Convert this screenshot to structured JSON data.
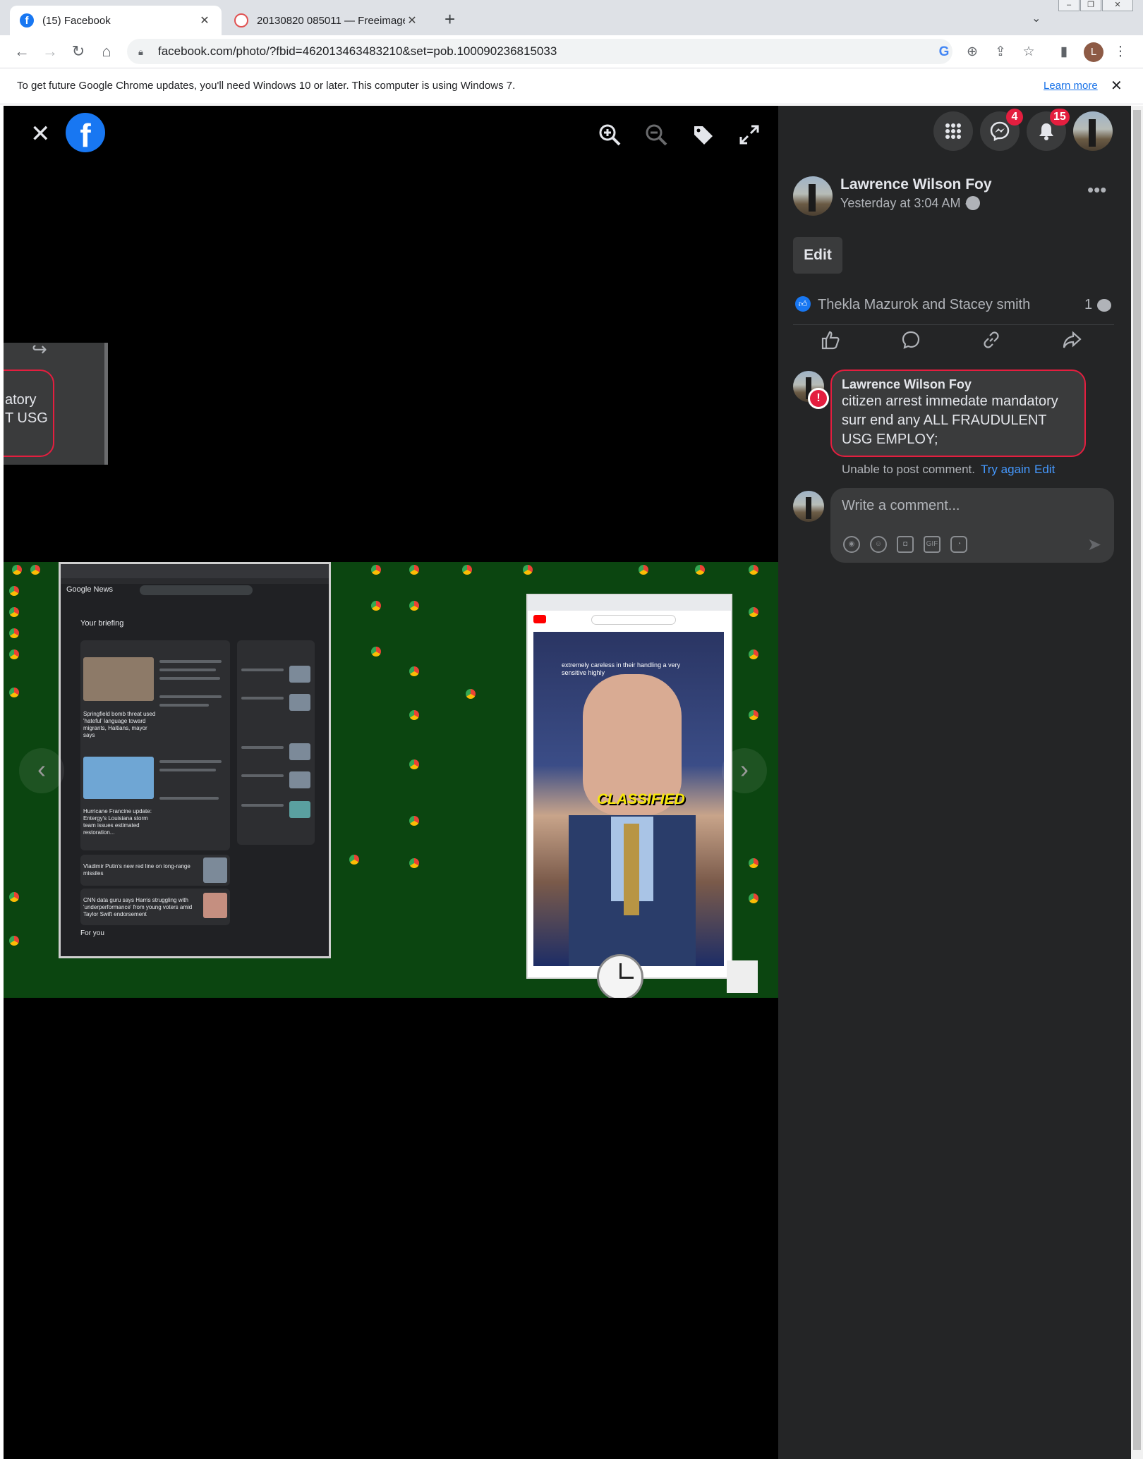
{
  "browser": {
    "tabs": [
      {
        "title": "(15) Facebook",
        "active": true
      },
      {
        "title": "20130820 085011 — Freeimage.host",
        "active": false
      }
    ],
    "new_tab": "+",
    "url": "facebook.com/photo/?fbid=462013463483210&set=pob.100090236815033",
    "profile_initial": "L",
    "infobar": {
      "message": "To get future Google Chrome updates, you'll need Windows 10 or later. This computer is using Windows 7.",
      "link": "Learn more"
    }
  },
  "viewer": {
    "snippet_text": "atory\nT USG",
    "photo": {
      "news_title": "Google News",
      "news_briefing": "Your briefing",
      "news_headline_1": "Springfield bomb threat used 'hateful' language toward migrants, Haitians, mayor says",
      "news_headline_2": "Hurricane Francine update: Entergy's Louisiana storm team issues estimated restoration...",
      "news_headline_3": "Vladimir Putin's new red line on long-range missiles",
      "news_headline_4": "CNN data guru says Harris struggling with 'underperformance' from young voters amid Taylor Swift endorsement",
      "news_for_you": "For you",
      "yt_caption": "extremely careless in their handling a very sensitive highly",
      "yt_overlay": "CLASSIFIED"
    }
  },
  "panel": {
    "badges": {
      "messenger": "4",
      "notifications": "15"
    },
    "post": {
      "author": "Lawrence Wilson Foy",
      "time": "Yesterday at 3:04 AM ·",
      "edit_label": "Edit",
      "reactions": "Thekla Mazurok and Stacey smith",
      "comment_count": "1"
    },
    "comment": {
      "author": "Lawrence Wilson Foy",
      "text": "citizen arrest immedate mandatory surr end any ALL FRAUDULENT USG EMPLOY;",
      "error": "Unable to post comment.",
      "try_again": "Try again",
      "edit": "Edit"
    },
    "composer": {
      "placeholder": "Write a comment..."
    }
  },
  "colors": {
    "facebook_blue": "#1877f2",
    "panel_bg": "#242526",
    "error_red": "#e41e3f",
    "link_blue": "#4599ff"
  }
}
